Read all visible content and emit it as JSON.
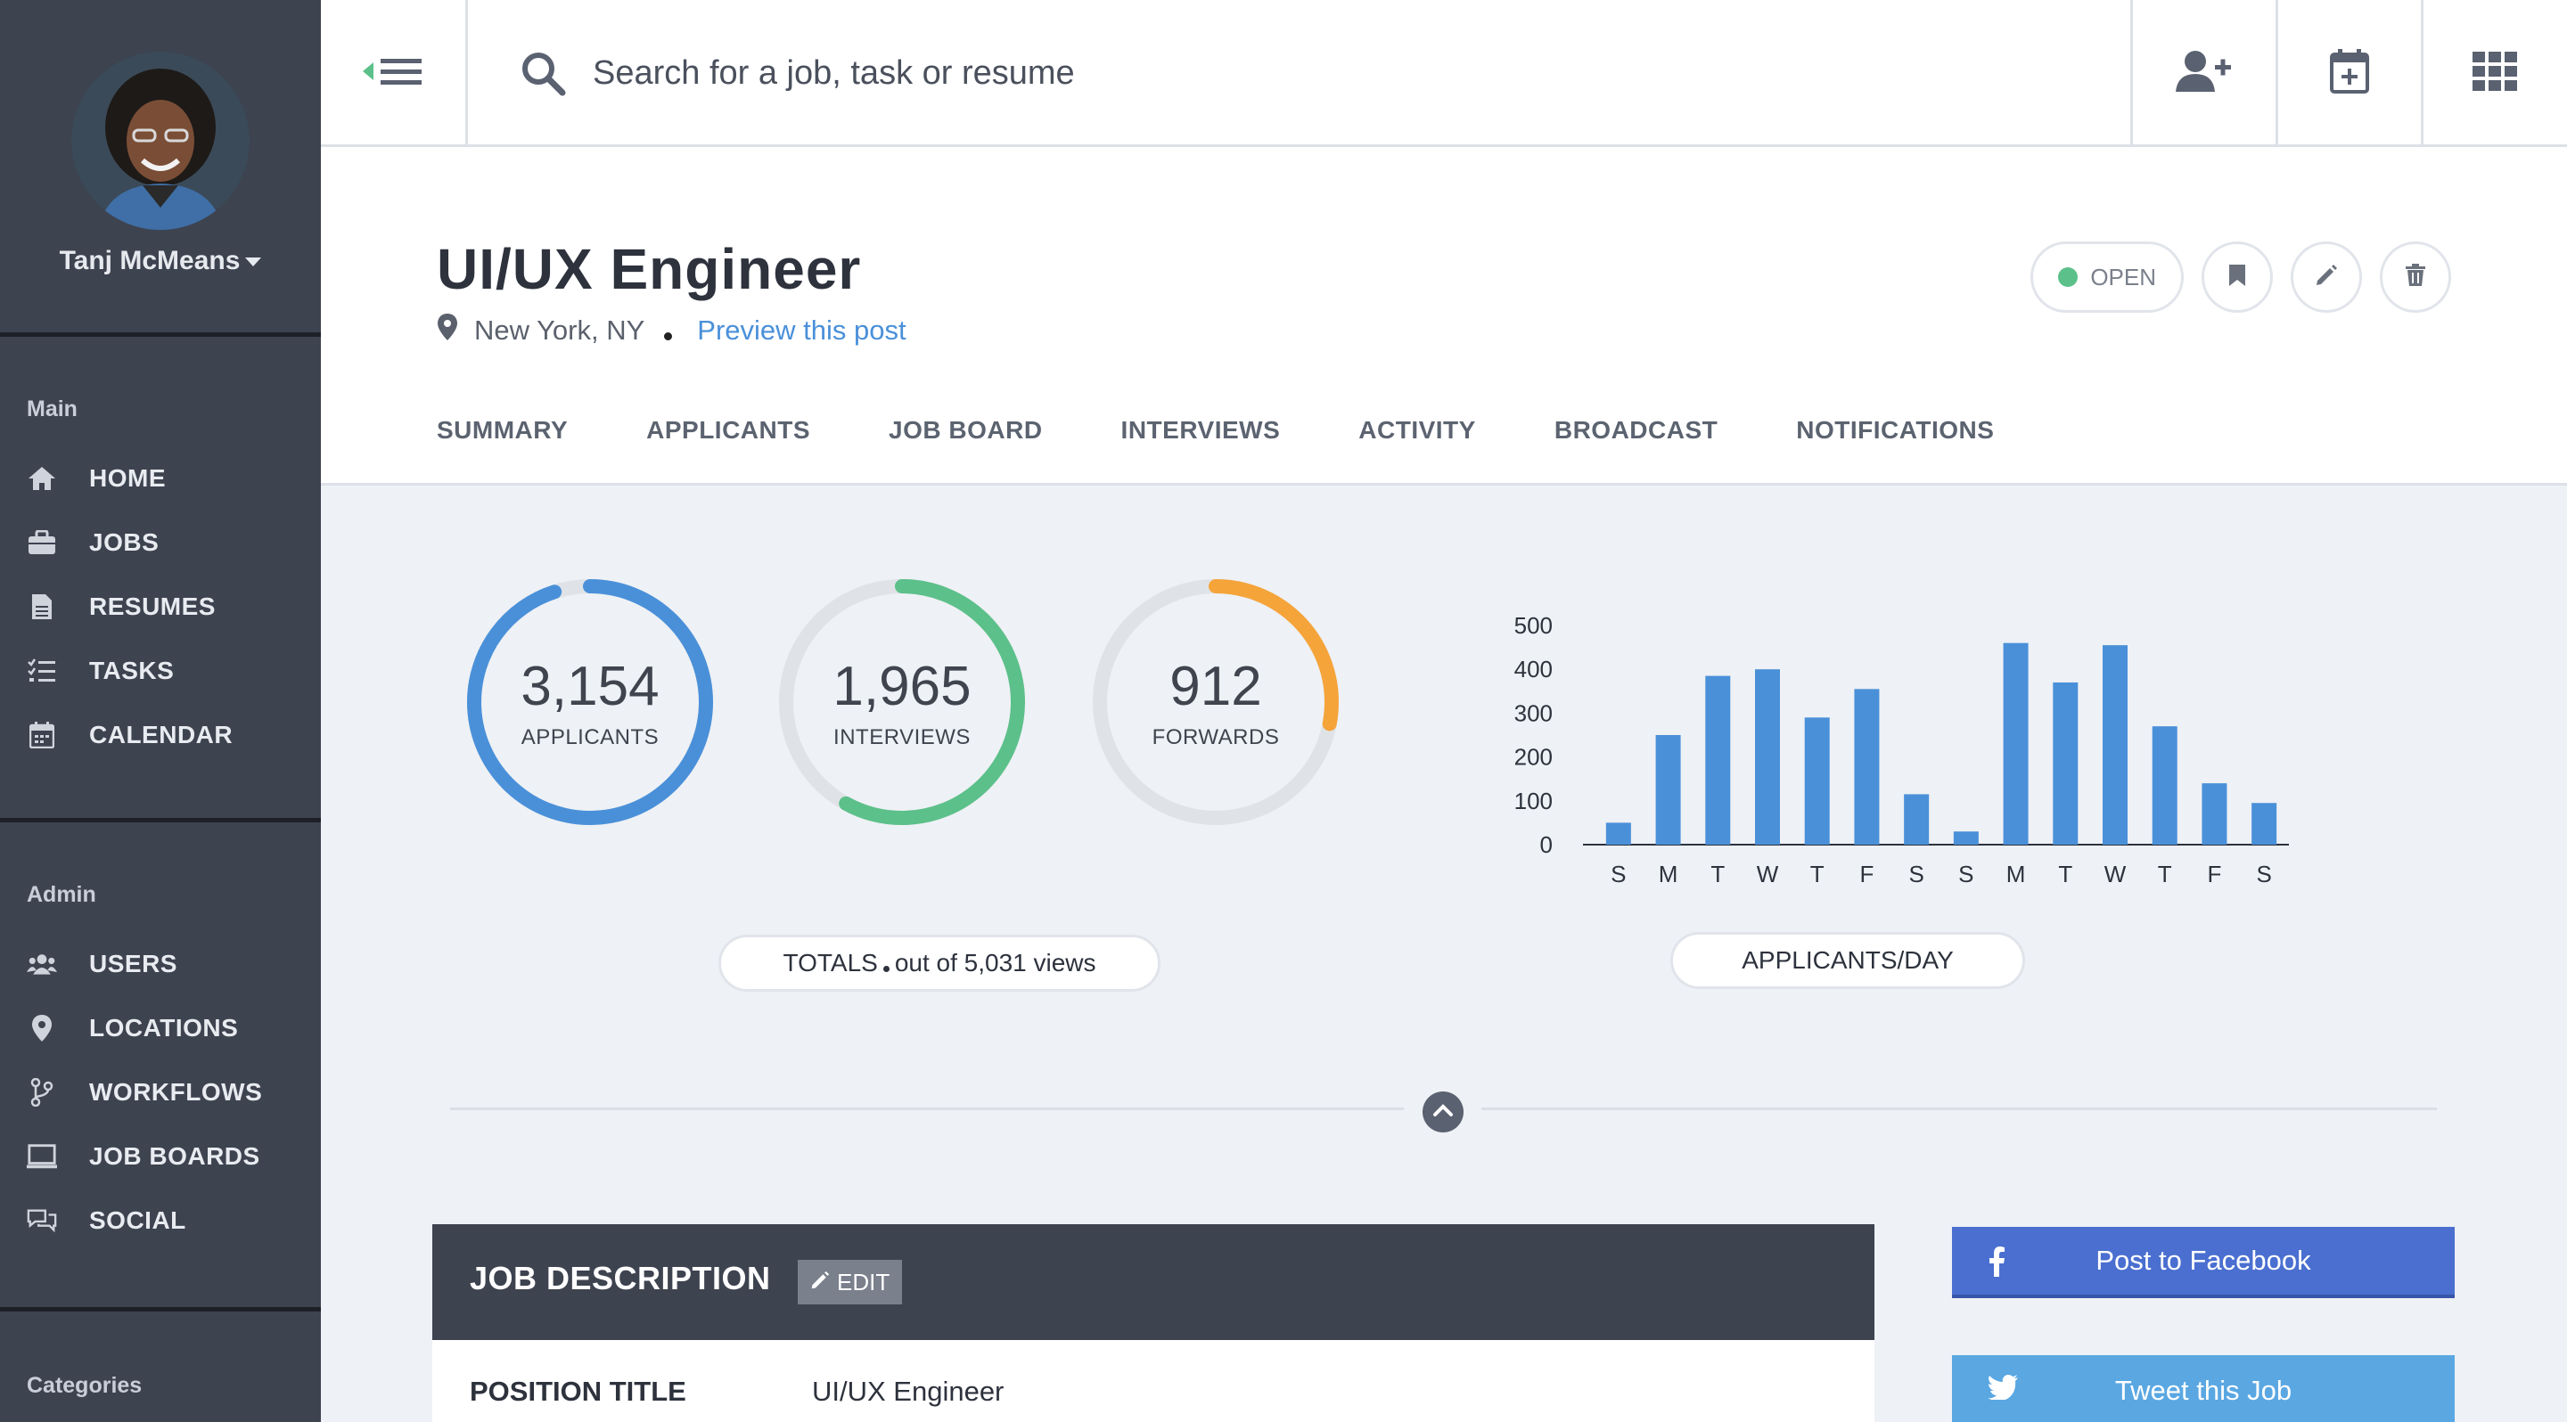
{
  "sidebar": {
    "user_name": "Tanj McMeans",
    "sections": [
      {
        "title": "Main",
        "items": [
          {
            "label": "HOME",
            "icon": "home-icon"
          },
          {
            "label": "JOBS",
            "icon": "briefcase-icon"
          },
          {
            "label": "RESUMES",
            "icon": "document-icon"
          },
          {
            "label": "TASKS",
            "icon": "tasks-icon"
          },
          {
            "label": "CALENDAR",
            "icon": "calendar-icon"
          }
        ]
      },
      {
        "title": "Admin",
        "items": [
          {
            "label": "USERS",
            "icon": "users-icon"
          },
          {
            "label": "LOCATIONS",
            "icon": "location-pin-icon"
          },
          {
            "label": "WORKFLOWS",
            "icon": "branch-icon"
          },
          {
            "label": "JOB BOARDS",
            "icon": "monitor-icon"
          },
          {
            "label": "SOCIAL",
            "icon": "chat-bubbles-icon"
          }
        ]
      },
      {
        "title": "Categories",
        "items": []
      }
    ]
  },
  "topbar": {
    "search_placeholder": "Search for a job, task or resume",
    "actions": [
      "add-user-icon",
      "calendar-plus-icon",
      "apps-grid-icon"
    ]
  },
  "job": {
    "title": "UI/UX Engineer",
    "location": "New York, NY",
    "preview_link": "Preview this post",
    "status": "OPEN",
    "status_color": "#5cc08a"
  },
  "tabs": [
    "SUMMARY",
    "APPLICANTS",
    "JOB BOARD",
    "INTERVIEWS",
    "ACTIVITY",
    "BROADCAST",
    "NOTIFICATIONS"
  ],
  "stats": [
    {
      "value": "3,154",
      "label": "APPLICANTS",
      "fraction": 0.95,
      "color": "#4a90d9"
    },
    {
      "value": "1,965",
      "label": "INTERVIEWS",
      "fraction": 0.58,
      "color": "#5cc08a"
    },
    {
      "value": "912",
      "label": "FORWARDS",
      "fraction": 0.28,
      "color": "#f5a43a"
    }
  ],
  "totals_caption": {
    "prefix": "TOTALS",
    "suffix": "out of 5,031 views"
  },
  "chart_data": {
    "type": "bar",
    "categories": [
      "S",
      "M",
      "T",
      "W",
      "T",
      "F",
      "S",
      "S",
      "M",
      "T",
      "W",
      "T",
      "F",
      "S"
    ],
    "values": [
      50,
      250,
      385,
      400,
      290,
      355,
      115,
      30,
      460,
      370,
      455,
      270,
      140,
      95
    ],
    "title": "APPLICANTS/DAY",
    "xlabel": "",
    "ylabel": "",
    "ylim": [
      0,
      500
    ],
    "yticks": [
      0,
      100,
      200,
      300,
      400,
      500
    ],
    "grid": false,
    "color": "#4a90d9"
  },
  "job_description": {
    "header": "JOB DESCRIPTION",
    "edit_label": "EDIT",
    "fields": [
      {
        "label": "POSITION TITLE",
        "value": "UI/UX Engineer"
      }
    ]
  },
  "social": {
    "facebook_label": "Post to Facebook",
    "twitter_label": "Tweet this Job"
  }
}
